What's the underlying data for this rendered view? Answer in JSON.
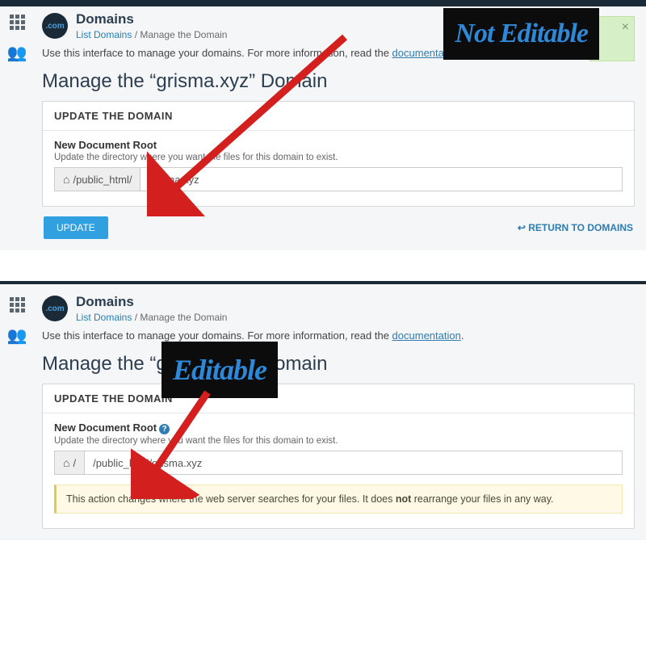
{
  "sidebar": {
    "apps_icon": "apps-grid",
    "users_icon": "users"
  },
  "page": {
    "icon_label": ".com",
    "title": "Domains",
    "crumb_link": "List Domains",
    "crumb_sep": "/",
    "crumb_current": "Manage the Domain",
    "intro_prefix": "Use this interface to manage your domains. For more information, read the ",
    "intro_link": "documentation",
    "intro_suffix": "."
  },
  "heading1": "Manage the “grisma.xyz” Domain",
  "well": {
    "head": "UPDATE THE DOMAIN"
  },
  "field": {
    "label": "New Document Root",
    "help": "Update the directory where you want the files for this domain to exist."
  },
  "top_input": {
    "addon": "/public_html/",
    "value": "grisma.xyz"
  },
  "bottom_input": {
    "addon": "/",
    "value": "/public_html/grisma.xyz"
  },
  "update_btn": "UPDATE",
  "return_link": "↩ RETURN TO DOMAINS",
  "warning_pre": "This action changes where the web server searches for your files. It does ",
  "warning_bold": "not",
  "warning_post": " rearrange your files in any way.",
  "overlay1": "Not Editable",
  "overlay2": "Editable",
  "close_x": "×",
  "help_q": "?"
}
